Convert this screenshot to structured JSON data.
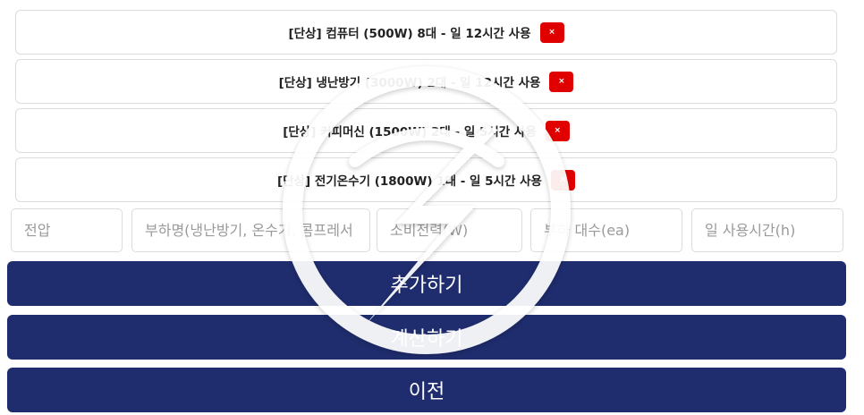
{
  "loads": [
    {
      "text": "[단상] 컴퓨터 (500W) 8대 - 일 12시간 사용",
      "remove_label": "×"
    },
    {
      "text": "[단상] 냉난방기 (3000W) 2대 - 일 12시간 사용",
      "remove_label": "×"
    },
    {
      "text": "[단상] 커피머신 (1500W) 2대 - 일 5시간 사용",
      "remove_label": "×"
    },
    {
      "text": "[단상] 전기온수기 (1800W) 1대 - 일 5시간 사용",
      "remove_label": "×"
    }
  ],
  "form": {
    "voltage_placeholder": "전압",
    "name_placeholder": "부하명(냉난방기, 온수기, 콤프레서 등)",
    "power_placeholder": "소비전력(W)",
    "count_placeholder": "부하 대수(ea)",
    "hours_placeholder": "일 사용시간(h)"
  },
  "buttons": {
    "add": "추가하기",
    "calculate": "계산하기",
    "back": "이전"
  },
  "colors": {
    "primary": "#1f2d6e",
    "remove": "#e00000"
  }
}
